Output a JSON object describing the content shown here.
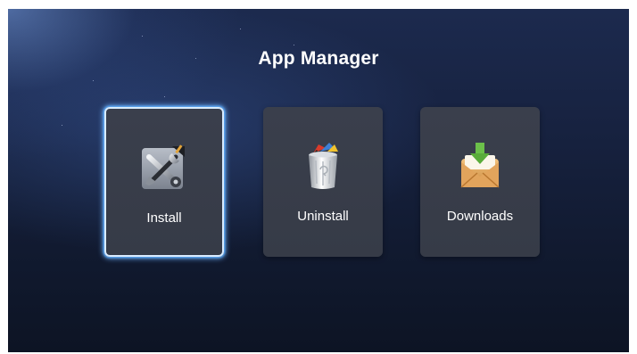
{
  "header": {
    "title": "App Manager"
  },
  "tiles": [
    {
      "label": "Install",
      "icon": "tools-icon",
      "selected": true
    },
    {
      "label": "Uninstall",
      "icon": "trash-can-icon",
      "selected": false
    },
    {
      "label": "Downloads",
      "icon": "download-box-icon",
      "selected": false
    }
  ],
  "colors": {
    "focus_border": "#d9ecff",
    "focus_glow": "#4aa8ff",
    "tile_bg": "#3a3f4c"
  }
}
